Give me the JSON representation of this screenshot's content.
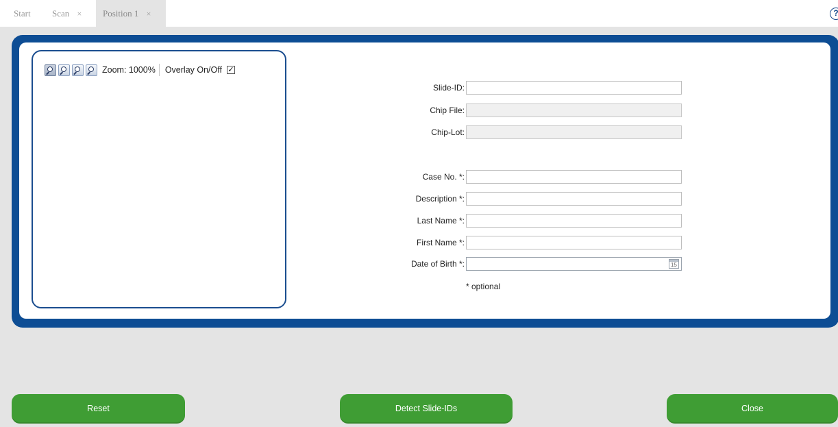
{
  "tabs": [
    {
      "label": "Start",
      "closable": false,
      "active": false
    },
    {
      "label": "Scan",
      "closable": true,
      "active": false
    },
    {
      "label": "Position 1",
      "closable": true,
      "active": true
    }
  ],
  "tab_close_glyph": "×",
  "help_icon": "?",
  "viewer": {
    "icons": [
      "zoom-fit-icon",
      "zoom-out-icon",
      "zoom-in-icon",
      "zoom-reset-icon"
    ],
    "zoom_label": "Zoom: 1000%",
    "overlay_label": "Overlay On/Off",
    "overlay_checked": true,
    "check_glyph": "✓"
  },
  "form": {
    "fields": [
      {
        "label": "Slide-ID:",
        "value": "",
        "enabled": true
      },
      {
        "label": "Chip File:",
        "value": "",
        "enabled": false
      },
      {
        "label": "Chip-Lot:",
        "value": "",
        "enabled": false
      },
      {
        "label": "Case No. *:",
        "value": "",
        "enabled": true
      },
      {
        "label": "Description *:",
        "value": "",
        "enabled": true
      },
      {
        "label": "Last Name *:",
        "value": "",
        "enabled": true
      },
      {
        "label": "First Name *:",
        "value": "",
        "enabled": true
      },
      {
        "label": "Date of Birth *:",
        "value": "",
        "enabled": true
      }
    ],
    "calendar_day": "15",
    "optional_note": "* optional"
  },
  "buttons": {
    "reset": "Reset",
    "detect": "Detect Slide-IDs",
    "close": "Close"
  },
  "colors": {
    "frame": "#0d4d94",
    "button_green": "#3f9d34",
    "background": "#e4e4e4"
  }
}
